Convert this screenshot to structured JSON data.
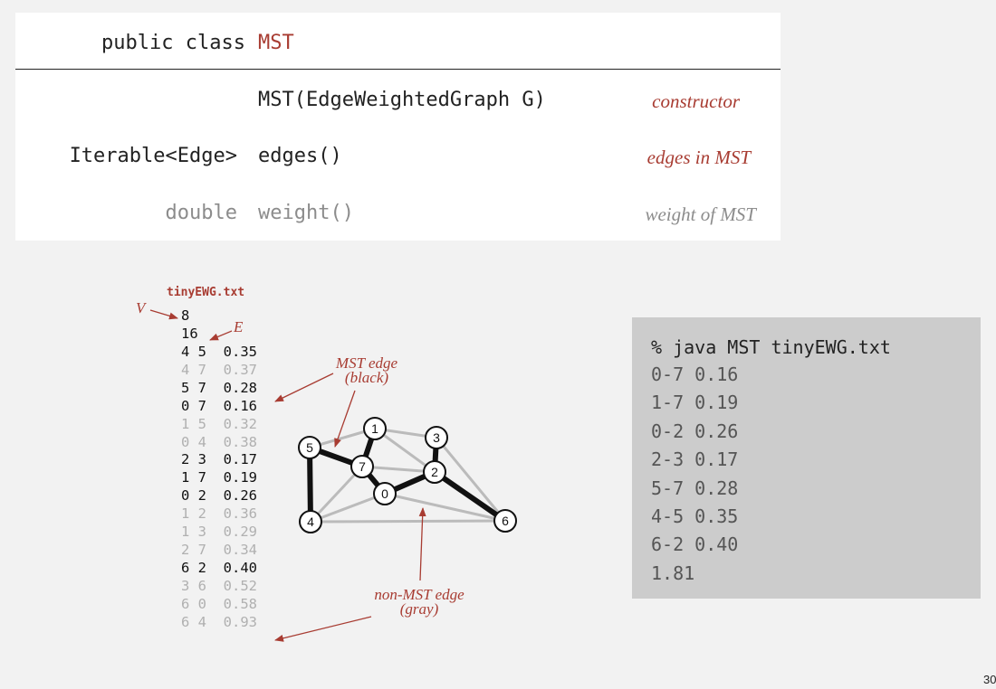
{
  "api": {
    "title_prefix": "public class",
    "title_class": "MST",
    "rows": [
      {
        "return_type": "",
        "signature": "MST(EdgeWeightedGraph G)",
        "description": "constructor"
      },
      {
        "return_type": "Iterable<Edge>",
        "signature": "edges()",
        "description": "edges in MST"
      },
      {
        "return_type": "double",
        "signature": "weight()",
        "description": "weight of MST"
      }
    ]
  },
  "file": {
    "name": "tinyEWG.txt",
    "v_label": "V",
    "e_label": "E",
    "v_count": "8",
    "e_count": "16",
    "edges": [
      {
        "text": "4 5  0.35",
        "mst": true
      },
      {
        "text": "4 7  0.37",
        "mst": false
      },
      {
        "text": "5 7  0.28",
        "mst": true
      },
      {
        "text": "0 7  0.16",
        "mst": true
      },
      {
        "text": "1 5  0.32",
        "mst": false
      },
      {
        "text": "0 4  0.38",
        "mst": false
      },
      {
        "text": "2 3  0.17",
        "mst": true
      },
      {
        "text": "1 7  0.19",
        "mst": true
      },
      {
        "text": "0 2  0.26",
        "mst": true
      },
      {
        "text": "1 2  0.36",
        "mst": false
      },
      {
        "text": "1 3  0.29",
        "mst": false
      },
      {
        "text": "2 7  0.34",
        "mst": false
      },
      {
        "text": "6 2  0.40",
        "mst": true
      },
      {
        "text": "3 6  0.52",
        "mst": false
      },
      {
        "text": "6 0  0.58",
        "mst": false
      },
      {
        "text": "6 4  0.93",
        "mst": false
      }
    ]
  },
  "annotations": {
    "mst_edge": "MST edge",
    "mst_edge_color": "(black)",
    "non_mst_edge": "non-MST edge",
    "non_mst_edge_color": "(gray)"
  },
  "graph": {
    "vertex_labels": [
      "0",
      "1",
      "2",
      "3",
      "4",
      "5",
      "6",
      "7"
    ],
    "mst_edges": [
      [
        4,
        5
      ],
      [
        5,
        7
      ],
      [
        0,
        7
      ],
      [
        2,
        3
      ],
      [
        1,
        7
      ],
      [
        0,
        2
      ],
      [
        6,
        2
      ]
    ],
    "non_mst_edges": [
      [
        4,
        7
      ],
      [
        1,
        5
      ],
      [
        0,
        4
      ],
      [
        1,
        2
      ],
      [
        1,
        3
      ],
      [
        2,
        7
      ],
      [
        3,
        6
      ],
      [
        6,
        0
      ],
      [
        6,
        4
      ]
    ]
  },
  "console": {
    "command": "% java MST tinyEWG.txt",
    "output": [
      "0-7 0.16",
      "1-7 0.19",
      "0-2 0.26",
      "2-3 0.17",
      "5-7 0.28",
      "4-5 0.35",
      "6-2 0.40",
      "1.81"
    ]
  },
  "page_number": "30",
  "colors": {
    "accent": "#a83c32",
    "mst_edge": "#111111",
    "non_mst_edge": "#bbbbbb"
  }
}
